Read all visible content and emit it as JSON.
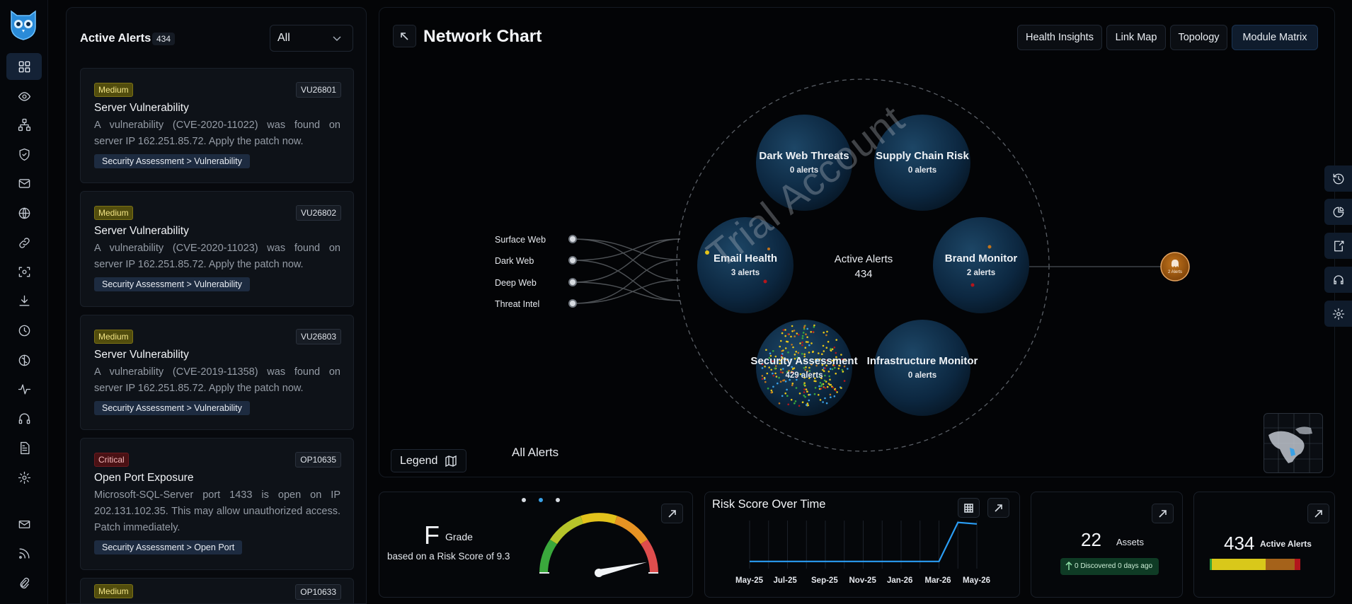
{
  "alerts_panel": {
    "title": "Active Alerts",
    "count": "434",
    "filter_value": "All",
    "cards": [
      {
        "severity": "Medium",
        "id": "VU26801",
        "title": "Server Vulnerability",
        "description": "A vulnerability (CVE-2020-11022) was found on server IP 162.251.85.72. Apply the patch now.",
        "tag": "Security Assessment > Vulnerability"
      },
      {
        "severity": "Medium",
        "id": "VU26802",
        "title": "Server Vulnerability",
        "description": "A vulnerability (CVE-2020-11023) was found on server IP 162.251.85.72. Apply the patch now.",
        "tag": "Security Assessment > Vulnerability"
      },
      {
        "severity": "Medium",
        "id": "VU26803",
        "title": "Server Vulnerability",
        "description": "A vulnerability (CVE-2019-11358) was found on server IP 162.251.85.72. Apply the patch now.",
        "tag": "Security Assessment > Vulnerability"
      },
      {
        "severity": "Critical",
        "id": "OP10635",
        "title": "Open Port Exposure",
        "description": "Microsoft-SQL-Server port 1433 is open on IP 202.131.102.35. This may allow unauthorized access. Patch immediately.",
        "tag": "Security Assessment > Open Port"
      },
      {
        "severity": "Medium",
        "id": "OP10633"
      }
    ]
  },
  "network": {
    "title": "Network Chart",
    "view_buttons": [
      "Health Insights",
      "Link Map",
      "Topology",
      "Module Matrix"
    ],
    "active_view": "Module Matrix",
    "sources": [
      "Surface Web",
      "Dark Web",
      "Deep Web",
      "Threat Intel"
    ],
    "center_label": "Active Alerts",
    "center_count": "434",
    "modules": [
      {
        "name": "Dark Web Threats",
        "alerts": "0 alerts"
      },
      {
        "name": "Supply Chain Risk",
        "alerts": "0 alerts"
      },
      {
        "name": "Email Health",
        "alerts": "3 alerts"
      },
      {
        "name": "Brand Monitor",
        "alerts": "2 alerts"
      },
      {
        "name": "Security Assessment",
        "alerts": "429 alerts"
      },
      {
        "name": "Infrastructure Monitor",
        "alerts": "0 alerts"
      }
    ],
    "brand_node_label": "2 Alerts",
    "watermark": "Trial Account",
    "legend_label": "Legend",
    "all_alerts_label": "All Alerts"
  },
  "grade_widget": {
    "grade": "F",
    "grade_label": "Grade",
    "description": "based on a Risk Score of 9.3",
    "risk_score": 9.3,
    "risk_score_max": 10,
    "carousel_active_index": 1,
    "carousel_count": 3
  },
  "risk_widget": {
    "title": "Risk Score Over Time"
  },
  "chart_data": {
    "type": "line",
    "x": [
      "May-25",
      "Jun-25",
      "Jul-25",
      "Aug-25",
      "Sep-25",
      "Oct-25",
      "Nov-25",
      "Dec-25",
      "Jan-26",
      "Feb-26",
      "Mar-26",
      "Apr-26",
      "May-26"
    ],
    "tick_labels": [
      "May-25",
      "Jul-25",
      "Sep-25",
      "Nov-25",
      "Jan-26",
      "Mar-26",
      "May-26"
    ],
    "series": [
      {
        "values": [
          1.5,
          1.5,
          1.5,
          1.5,
          1.5,
          1.5,
          1.5,
          1.5,
          1.5,
          1.5,
          1.5,
          9.6,
          9.3
        ]
      }
    ],
    "title": "Risk Score Over Time",
    "xlabel": "",
    "ylabel": "",
    "ylim": [
      0,
      10
    ],
    "grid": "vertical",
    "color": "#2a9df4"
  },
  "assets_widget": {
    "count": "22",
    "label": "Assets",
    "discovered": "0 Discovered 0 days ago"
  },
  "active_alerts_widget": {
    "count": "434",
    "label": "Active Alerts",
    "bar_segments": [
      {
        "fraction": 0.02,
        "color": "#2f9f3c"
      },
      {
        "fraction": 0.6,
        "color": "#d9c81a"
      },
      {
        "fraction": 0.32,
        "color": "#a5621a"
      },
      {
        "fraction": 0.06,
        "color": "#b3141c"
      }
    ]
  }
}
